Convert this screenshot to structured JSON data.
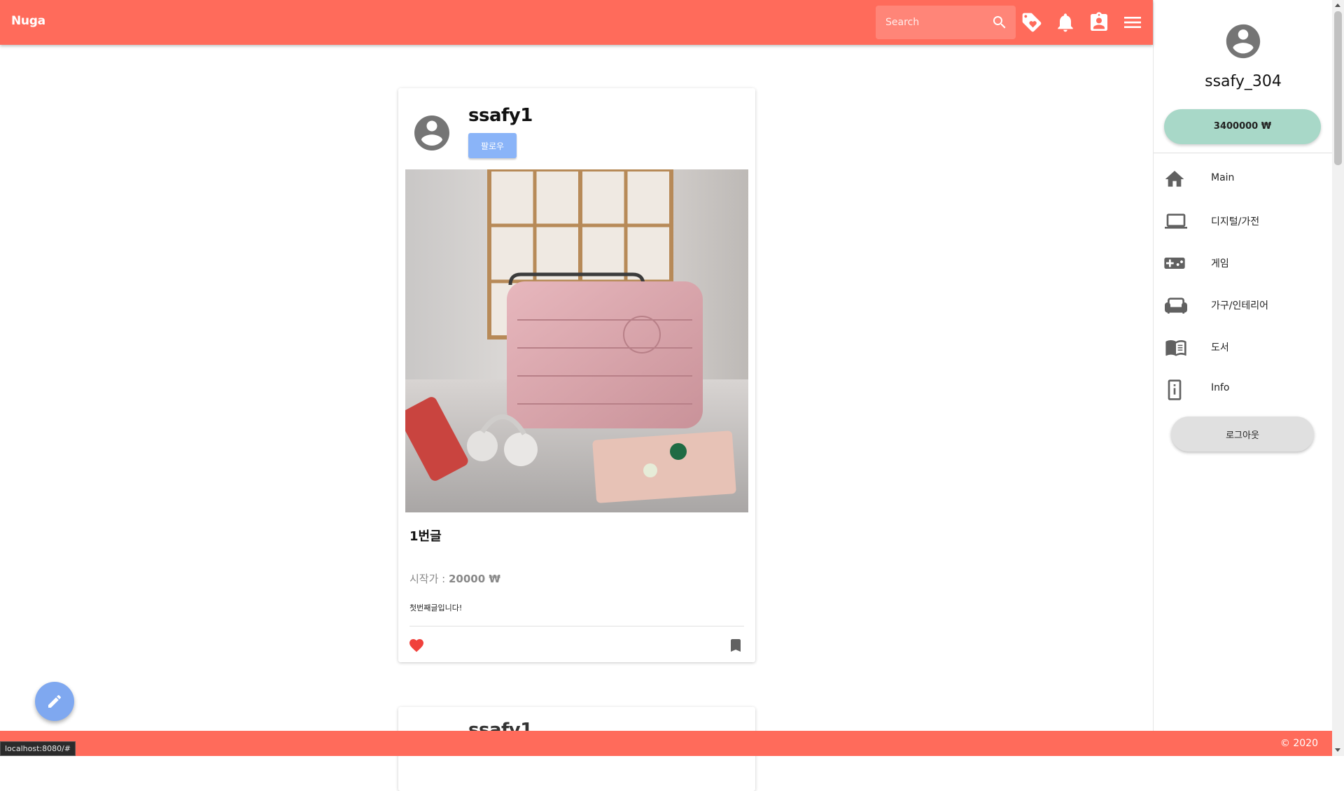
{
  "app": {
    "brand": "Nuga",
    "accent_color": "#ff6b5b"
  },
  "header": {
    "search_placeholder": "Search",
    "icons": [
      "search-icon",
      "tag-heart-icon",
      "bell-icon",
      "contact-badge-icon",
      "menu-icon"
    ]
  },
  "feed": {
    "posts": [
      {
        "username": "ssafy1",
        "follow_label": "팔로우",
        "title": "1번글",
        "start_price_label": "시작가 : ",
        "start_price_value": "20000 ₩",
        "body": "첫번째글입니다!",
        "image_icon": "pink-suitcase-product-photo"
      },
      {
        "username": "ssafy1"
      }
    ]
  },
  "drawer": {
    "username": "ssafy_304",
    "balance": "3400000 ₩",
    "balance_color": "#a8d8c8",
    "nav": [
      {
        "label": "Main",
        "icon": "home-icon"
      },
      {
        "label": "디지털/가전",
        "icon": "laptop-icon"
      },
      {
        "label": "게임",
        "icon": "gamepad-icon"
      },
      {
        "label": "가구/인테리어",
        "icon": "sofa-icon"
      },
      {
        "label": "도서",
        "icon": "book-icon"
      },
      {
        "label": "Info",
        "icon": "info-icon"
      }
    ],
    "logout_label": "로그아웃"
  },
  "footer": {
    "text": "© 2020"
  },
  "status_bar": {
    "url": "localhost:8080/#"
  },
  "fab": {
    "icon": "pencil-icon"
  }
}
